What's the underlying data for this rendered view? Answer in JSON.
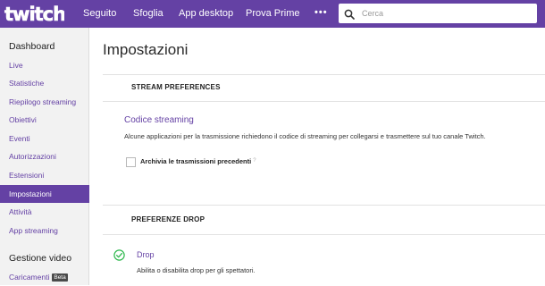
{
  "brand": {
    "logo_text": "twitch",
    "accent": "#6441a4"
  },
  "topnav": {
    "items": [
      "Seguito",
      "Sfoglia",
      "App desktop",
      "Prova Prime"
    ],
    "more_label": "•••",
    "search_placeholder": "Cerca"
  },
  "sidebar": {
    "dashboard_heading": "Dashboard",
    "items": [
      "Live",
      "Statistiche",
      "Riepilogo streaming",
      "Obiettivi",
      "Eventi",
      "Autorizzazioni",
      "Estensioni",
      "Impostazioni",
      "Attività",
      "App streaming"
    ],
    "active_item": "Impostazioni",
    "video_heading": "Gestione video",
    "uploads_label": "Caricamenti",
    "beta_badge": "Beta"
  },
  "main": {
    "title": "Impostazioni",
    "stream_section": {
      "heading": "STREAM PREFERENCES",
      "key_title": "Codice streaming",
      "key_desc": "Alcune applicazioni per la trasmissione richiedono il codice di streaming per collegarsi e trasmettere sul tuo canale Twitch.",
      "archive_label": "Archivia le trasmissioni precedenti",
      "archive_checked": false,
      "help_mark": "?"
    },
    "drop_section": {
      "heading": "PREFERENZE DROP",
      "drop_title": "Drop",
      "drop_desc": "Abilita o disabilita drop per gli spettatori.",
      "drop_enabled": true,
      "status_color": "#2db84d"
    }
  }
}
